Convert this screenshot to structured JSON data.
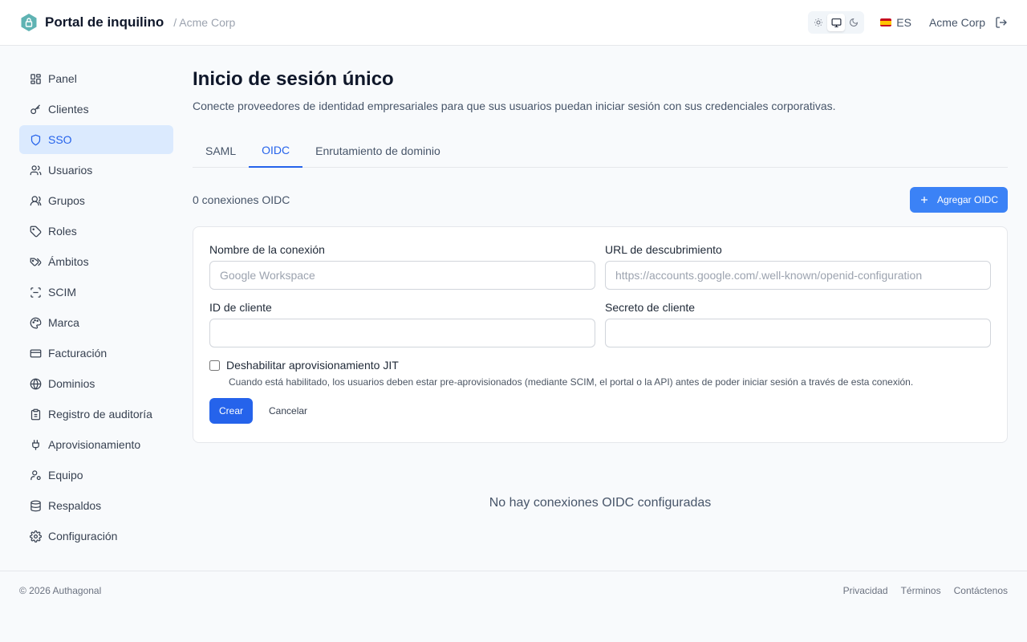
{
  "header": {
    "brand": "Portal de inquilino",
    "org_breadcrumb": "/ Acme Corp",
    "language": "ES",
    "org_name": "Acme Corp",
    "logo_icon": "shield-lock-icon",
    "theme_options": [
      "sun-icon",
      "monitor-icon",
      "moon-icon"
    ],
    "theme_selected": "monitor-icon"
  },
  "sidebar": {
    "items": [
      {
        "label": "Panel",
        "icon": "dashboard-icon"
      },
      {
        "label": "Clientes",
        "icon": "key-icon"
      },
      {
        "label": "SSO",
        "icon": "shield-icon",
        "active": true
      },
      {
        "label": "Usuarios",
        "icon": "users-icon"
      },
      {
        "label": "Grupos",
        "icon": "group-icon"
      },
      {
        "label": "Roles",
        "icon": "tag-icon"
      },
      {
        "label": "Ámbitos",
        "icon": "tags-icon"
      },
      {
        "label": "SCIM",
        "icon": "scan-icon"
      },
      {
        "label": "Marca",
        "icon": "palette-icon"
      },
      {
        "label": "Facturación",
        "icon": "credit-card-icon"
      },
      {
        "label": "Dominios",
        "icon": "globe-icon"
      },
      {
        "label": "Registro de auditoría",
        "icon": "clipboard-icon"
      },
      {
        "label": "Aprovisionamiento",
        "icon": "plug-icon"
      },
      {
        "label": "Equipo",
        "icon": "user-cog-icon"
      },
      {
        "label": "Respaldos",
        "icon": "database-icon"
      },
      {
        "label": "Configuración",
        "icon": "gear-icon"
      }
    ]
  },
  "main": {
    "title": "Inicio de sesión único",
    "description": "Conecte proveedores de identidad empresariales para que sus usuarios puedan iniciar sesión con sus credenciales corporativas.",
    "tabs": [
      {
        "label": "SAML"
      },
      {
        "label": "OIDC",
        "active": true
      },
      {
        "label": "Enrutamiento de dominio"
      }
    ],
    "count_label": "0 conexiones OIDC",
    "add_button": "Agregar OIDC",
    "form": {
      "name_label": "Nombre de la conexión",
      "name_placeholder": "Google Workspace",
      "discovery_label": "URL de descubrimiento",
      "discovery_placeholder": "https://accounts.google.com/.well-known/openid-configuration",
      "client_id_label": "ID de cliente",
      "client_secret_label": "Secreto de cliente",
      "jit_label": "Deshabilitar aprovisionamiento JIT",
      "jit_help": "Cuando está habilitado, los usuarios deben estar pre-aprovisionados (mediante SCIM, el portal o la API) antes de poder iniciar sesión a través de esta conexión.",
      "create_button": "Crear",
      "cancel_button": "Cancelar"
    },
    "empty_state": "No hay conexiones OIDC configuradas"
  },
  "footer": {
    "copyright": "© 2026 Authagonal",
    "links": [
      "Privacidad",
      "Términos",
      "Contáctenos"
    ]
  },
  "colors": {
    "accent": "#2563eb",
    "accent_light": "#dbeafe",
    "logo": "#5fb3b3"
  }
}
